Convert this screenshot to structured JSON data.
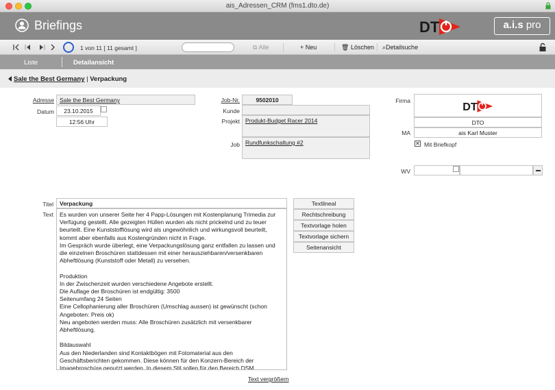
{
  "window": {
    "title": "ais_Adressen_CRM (fms1.dto.de)"
  },
  "header": {
    "module_title": "Briefings",
    "brand_a": "a.i.s",
    "brand_b": "pro"
  },
  "toolbar": {
    "record_info": "1 von 11  [ 11 gesamt ]",
    "search_value": "",
    "all_label": "Alle",
    "new_label": "Neu",
    "delete_label": "Löschen",
    "detail_search_label": "Detailsuche"
  },
  "tabs": {
    "list": "Liste",
    "detail": "Detailansicht"
  },
  "breadcrumb": {
    "parent": "Sale the Best Germany",
    "separator": " | ",
    "current": "Verpackung"
  },
  "form": {
    "adresse_label": "Adresse",
    "adresse_value": "Sale the Best Germany",
    "datum_label": "Datum",
    "datum_value": "23.10.2015",
    "time_value": "12:56 Uhr",
    "jobnr_label": "Job-Nr.",
    "jobnr_value": "9502010",
    "kunde_label": "Kunde",
    "kunde_value": "",
    "projekt_label": "Projekt",
    "projekt_value": "Produkt-Budget Racer 2014",
    "job_label": "Job",
    "job_value": "Rundfunkschaltung #2",
    "firma_label": "Firma",
    "firma_value": "DTO",
    "ma_label": "MA",
    "ma_value": "ais Karl Muster",
    "briefkopf_label": "Mit Briefkopf",
    "briefkopf_checked": true,
    "wv_label": "WV",
    "titel_label": "Titel",
    "titel_value": "Verpackung",
    "text_label": "Text",
    "text_value": "Es wurden von unserer Seite her 4 Papp-Lösungen mit Kostenplanung Trimedia zur Verfügung gestellt. Alle gezeigten Hüllen wurden als nicht prickelnd und zu teuer beurteilt. Eine Kunststofflösung wird als ungewöhnlich und wirkungsvoll beurteilt, kommt aber ebenfalls aus Kostengründen nicht in Frage.\nIm Gespräch wurde überlegt, eine Verpackungslösung ganz entfallen zu lassen und die einzelnen Broschüren stattdessen mit einer herausziehbaren/versenkbaren Abheftlösung (Kunststoff oder Metall) zu versehen.\n\nProduktion\nIn der Zwischenzeit wurden verschiedene Angebote erstellt.\nDie Auflage der Broschüren ist endgültig: 3500\nSeitenumfang 24 Seiten\nEine Cellophanierung aller Broschüren (Umschlag aussen) ist gewünscht (schon Angeboten: Preis ok)\nNeu angeboten werden muss: Alle Broschüren zusätzlich mit versenkbarer Abheftlösung.\n\nBildauswahl\nAus den Niederlanden sind Kontaktbögen mit Fotomaterial aus den Geschäftsberichten gekommen. Diese können für den Konzern-Bereich der Imagebroschüre genutzt werden. In diesem Stil sollen für den Bereich DSM",
    "text_enlarge": "Text vergrößern"
  },
  "side_buttons": [
    "Textlineal",
    "Rechtschreibung",
    "Textvorlage holen",
    "Textvorlage sichern",
    "Seitenansicht"
  ],
  "colors": {
    "header_bg": "#8a8a8a",
    "tabbar_bg": "#9c9c9c",
    "accent_blue": "#2a5fcc",
    "logo_red": "#e2231a"
  }
}
